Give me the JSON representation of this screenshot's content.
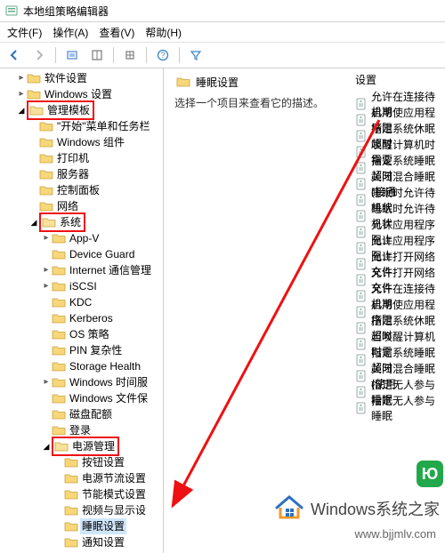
{
  "window": {
    "title": "本地组策略编辑器"
  },
  "menu": {
    "file": "文件(F)",
    "action": "操作(A)",
    "view": "查看(V)",
    "help": "帮助(H)"
  },
  "toolbar_icons": {
    "back": "back-icon",
    "forward": "forward-icon",
    "up": "up-icon",
    "show": "show-icon",
    "export": "export-icon",
    "help": "help-icon",
    "filter": "filter-icon"
  },
  "tree": {
    "level1": [
      {
        "label": "软件设置",
        "expanded": false,
        "indent": 1,
        "arrow": true
      },
      {
        "label": "Windows 设置",
        "expanded": false,
        "indent": 1,
        "arrow": true
      },
      {
        "label": "管理模板",
        "expanded": true,
        "indent": 1,
        "arrow": true,
        "highlight": true
      },
      {
        "label": "\"开始\"菜单和任务栏",
        "expanded": false,
        "indent": 2,
        "arrow": false
      },
      {
        "label": "Windows 组件",
        "expanded": false,
        "indent": 2,
        "arrow": false
      },
      {
        "label": "打印机",
        "expanded": false,
        "indent": 2,
        "arrow": false
      },
      {
        "label": "服务器",
        "expanded": false,
        "indent": 2,
        "arrow": false
      },
      {
        "label": "控制面板",
        "expanded": false,
        "indent": 2,
        "arrow": false
      },
      {
        "label": "网络",
        "expanded": false,
        "indent": 2,
        "arrow": false
      },
      {
        "label": "系统",
        "expanded": true,
        "indent": 2,
        "arrow": true,
        "highlight": true
      },
      {
        "label": "App-V",
        "expanded": false,
        "indent": 3,
        "arrow": true
      },
      {
        "label": "Device Guard",
        "expanded": false,
        "indent": 3,
        "arrow": false
      },
      {
        "label": "Internet 通信管理",
        "expanded": false,
        "indent": 3,
        "arrow": true
      },
      {
        "label": "iSCSI",
        "expanded": false,
        "indent": 3,
        "arrow": true
      },
      {
        "label": "KDC",
        "expanded": false,
        "indent": 3,
        "arrow": false
      },
      {
        "label": "Kerberos",
        "expanded": false,
        "indent": 3,
        "arrow": false
      },
      {
        "label": "OS 策略",
        "expanded": false,
        "indent": 3,
        "arrow": false
      },
      {
        "label": "PIN 复杂性",
        "expanded": false,
        "indent": 3,
        "arrow": false
      },
      {
        "label": "Storage Health",
        "expanded": false,
        "indent": 3,
        "arrow": false
      },
      {
        "label": "Windows 时间服",
        "expanded": false,
        "indent": 3,
        "arrow": true
      },
      {
        "label": "Windows 文件保",
        "expanded": false,
        "indent": 3,
        "arrow": false
      },
      {
        "label": "磁盘配额",
        "expanded": false,
        "indent": 3,
        "arrow": false
      },
      {
        "label": "登录",
        "expanded": false,
        "indent": 3,
        "arrow": false
      },
      {
        "label": "电源管理",
        "expanded": true,
        "indent": 3,
        "arrow": true,
        "highlight": true
      },
      {
        "label": "按钮设置",
        "expanded": false,
        "indent": 4,
        "arrow": false
      },
      {
        "label": "电源节流设置",
        "expanded": false,
        "indent": 4,
        "arrow": false
      },
      {
        "label": "节能模式设置",
        "expanded": false,
        "indent": 4,
        "arrow": false
      },
      {
        "label": "视频与显示设",
        "expanded": false,
        "indent": 4,
        "arrow": false
      },
      {
        "label": "睡眠设置",
        "expanded": false,
        "indent": 4,
        "arrow": false,
        "selected": true
      },
      {
        "label": "通知设置",
        "expanded": false,
        "indent": 4,
        "arrow": false
      }
    ]
  },
  "right": {
    "header_label": "睡眠设置",
    "prompt": "选择一个项目来查看它的描述。",
    "settings_header": "设置",
    "settings": [
      "允许在连接待机期",
      "启用使应用程序阻",
      "指定系统休眠超时",
      "唤醒计算机时需要",
      "指定系统睡眠超时",
      "关闭混合睡眠(接通",
      "睡眠时允许待机状",
      "睡眠时允许待机状",
      "允许应用程序阻止",
      "允许应用程序阻止",
      "允许打开网络文件",
      "允许打开网络文件",
      "允许在连接待机期",
      "启用使应用程序阻",
      "指定系统休眠超时",
      "当唤醒计算机时需",
      "指定系统睡眠超时",
      "关闭混合睡眠(使用",
      "指定无人参与睡眠",
      "指定无人参与睡眠"
    ]
  },
  "watermark": {
    "brand": "Windows系统之家",
    "url": "www.bjjmlv.com"
  }
}
